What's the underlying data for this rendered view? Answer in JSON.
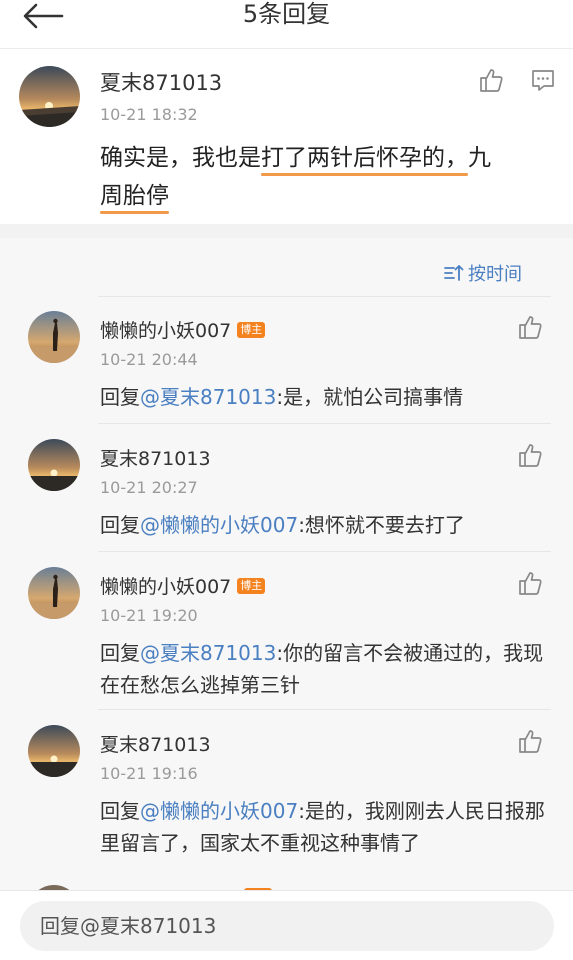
{
  "header": {
    "title": "5条回复"
  },
  "main": {
    "username": "夏末871013",
    "time": "10-21 18:32",
    "text_part1": "确实是，我也是",
    "text_highlight1": "打了两针后怀孕的，",
    "text_part2": "九",
    "text_highlight2": "周胎停"
  },
  "sort": {
    "label": "按时间"
  },
  "replies": [
    {
      "username": "懒懒的小妖007",
      "badge": "博主",
      "time": "10-21 20:44",
      "prefix": "回复",
      "mention": "@夏末871013",
      "text": ":是，就怕公司搞事情"
    },
    {
      "username": "夏末871013",
      "badge": "",
      "time": "10-21 20:27",
      "prefix": "回复",
      "mention": "@懒懒的小妖007",
      "text": ":想怀就不要去打了"
    },
    {
      "username": "懒懒的小妖007",
      "badge": "博主",
      "time": "10-21 19:20",
      "prefix": "回复",
      "mention": "@夏末871013",
      "text": ":你的留言不会被通过的，我现在在愁怎么逃掉第三针"
    },
    {
      "username": "夏末871013",
      "badge": "",
      "time": "10-21 19:16",
      "prefix": "回复",
      "mention": "@懒懒的小妖007",
      "text": ":是的，我刚刚去人民日报那里留言了，国家太不重视这种事情了"
    }
  ],
  "input": {
    "placeholder": "回复@夏末871013"
  },
  "colors": {
    "accent": "#f2994a",
    "link": "#4a7fc1",
    "badge": "#f4821f"
  }
}
